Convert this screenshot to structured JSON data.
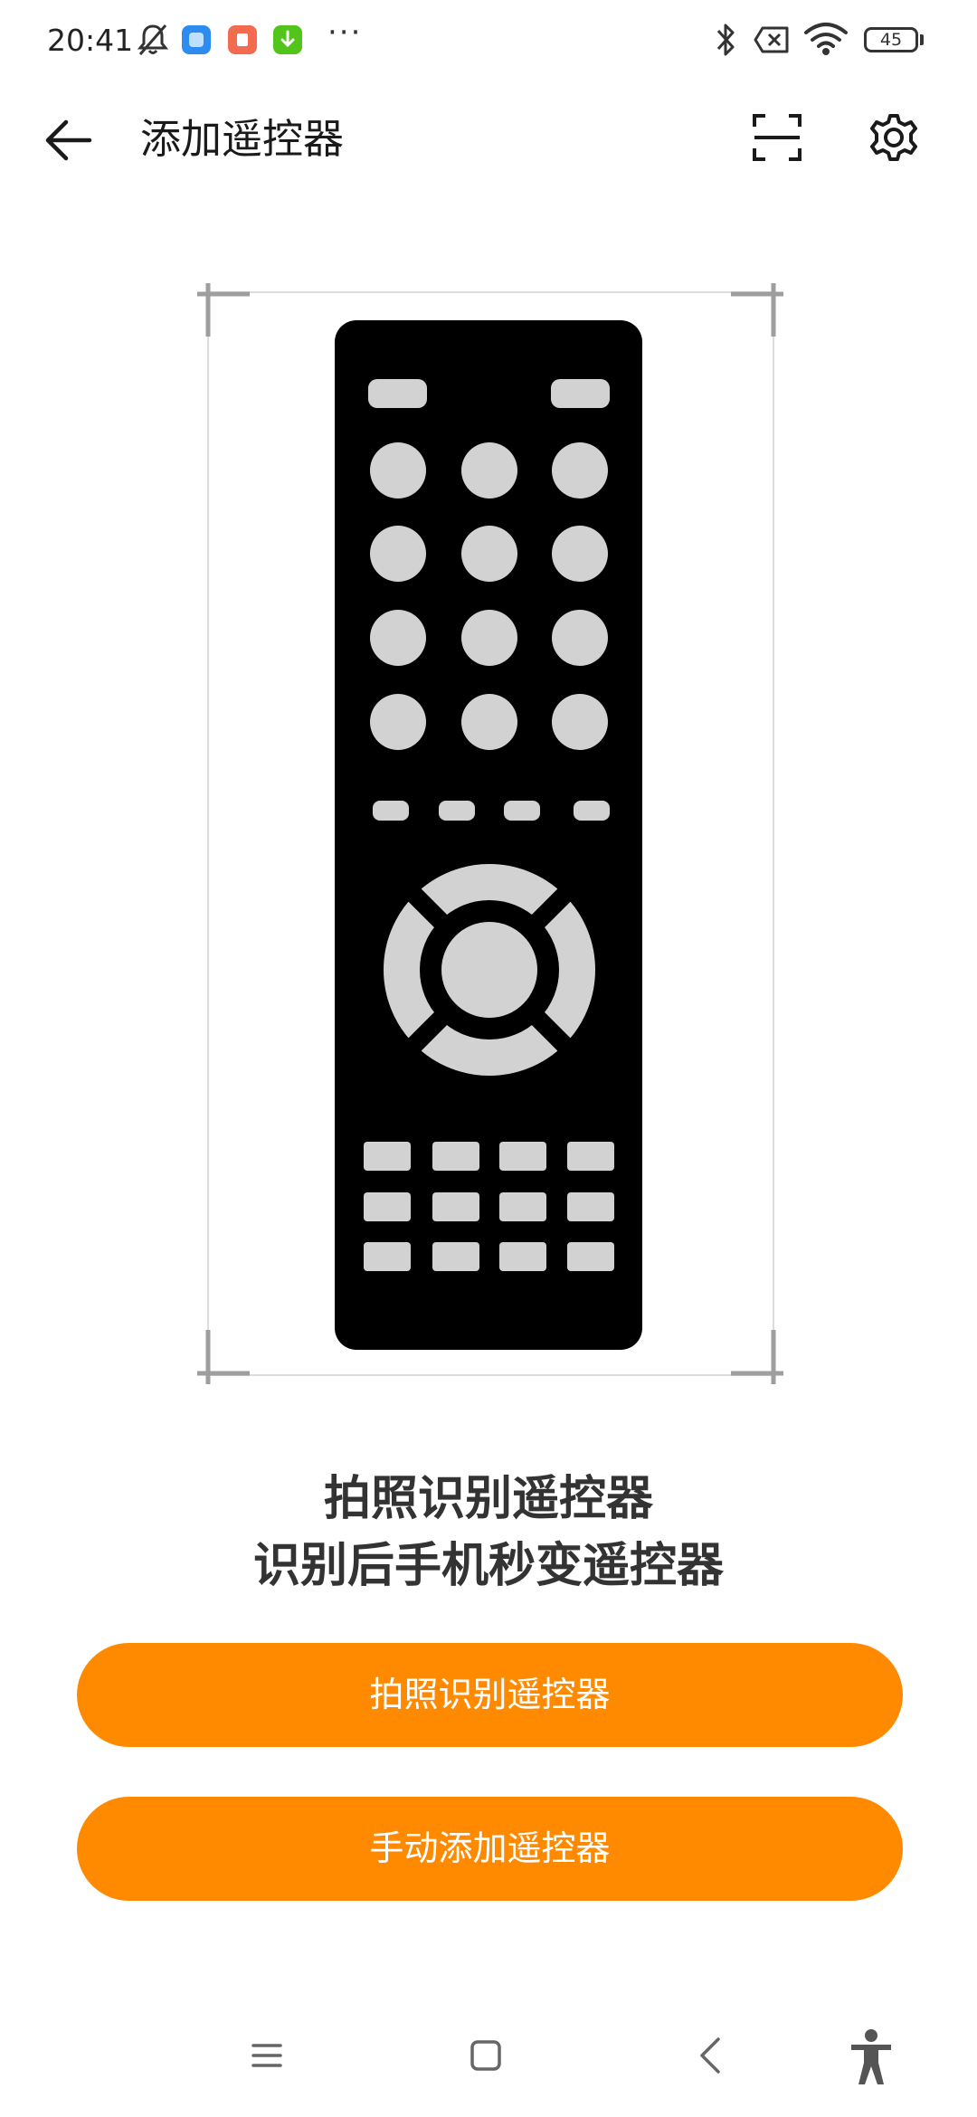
{
  "status_bar": {
    "time": "20:41",
    "overflow": "···",
    "battery_level": "45",
    "icons": [
      "bell-mute-icon",
      "app-notification-blue",
      "app-notification-red",
      "app-notification-green",
      "bluetooth-icon",
      "no-sim-icon",
      "wifi-icon",
      "battery-icon"
    ],
    "badge_colors": [
      "#2e8cf0",
      "#f26b4f",
      "#52c41a"
    ]
  },
  "header": {
    "title": "添加遥控器",
    "back_icon": "arrow-left-icon",
    "scan_icon": "scan-frame-icon",
    "settings_icon": "gear-icon"
  },
  "illustration": {
    "subject": "remote-control-illustration"
  },
  "caption": {
    "line1": "拍照识别遥控器",
    "line2": "识别后手机秒变遥控器"
  },
  "buttons": {
    "photo_identify": "拍照识别遥控器",
    "manual_add": "手动添加遥控器"
  },
  "accent_color": "#ff8a00",
  "nav_bar": {
    "icons": [
      "menu-icon",
      "home-icon",
      "back-icon",
      "accessibility-icon"
    ]
  }
}
